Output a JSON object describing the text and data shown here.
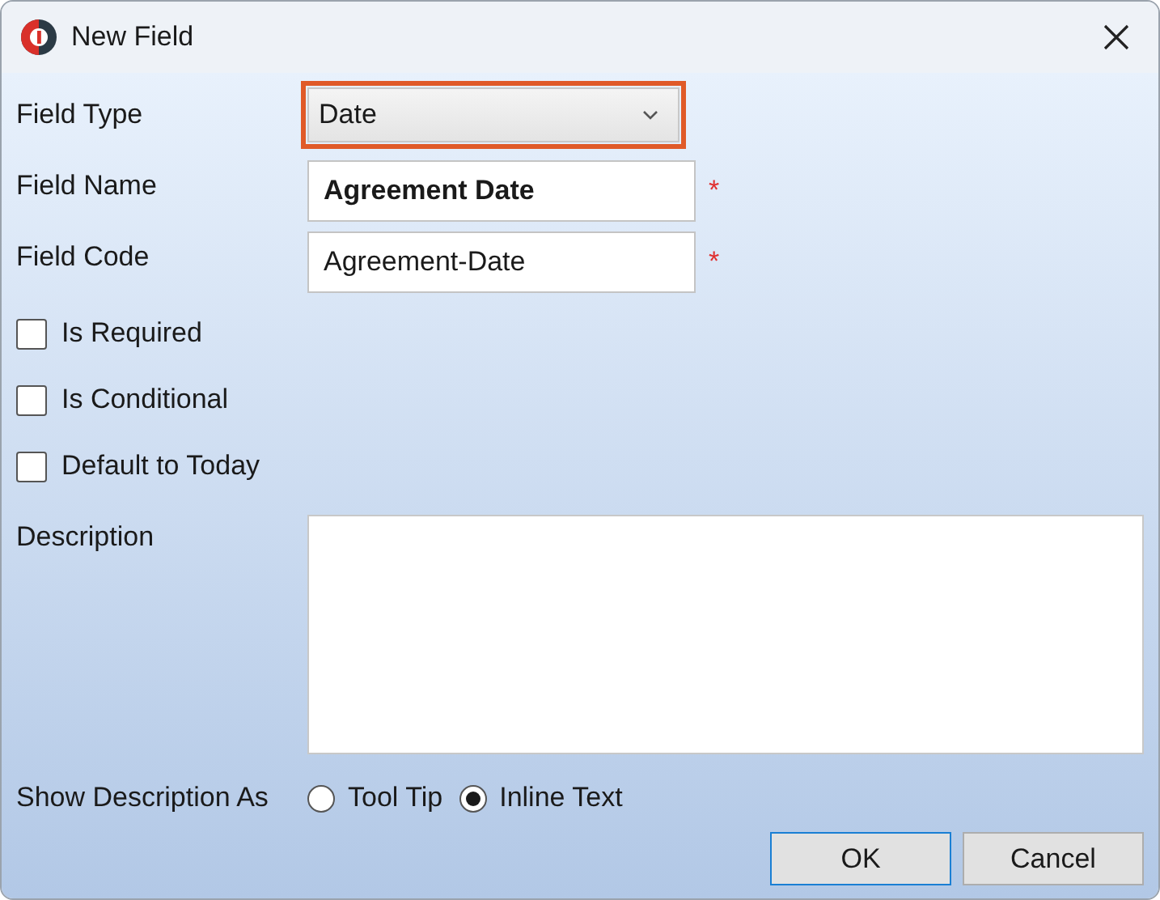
{
  "window": {
    "title": "New Field"
  },
  "field_type": {
    "label": "Field Type",
    "value": "Date",
    "highlighted": true
  },
  "field_name": {
    "label": "Field Name",
    "value": "Agreement Date",
    "required_mark": "*"
  },
  "field_code": {
    "label": "Field Code",
    "value": "Agreement-Date",
    "required_mark": "*"
  },
  "checkboxes": [
    {
      "label": "Is Required",
      "checked": false
    },
    {
      "label": "Is Conditional",
      "checked": false
    },
    {
      "label": "Default to Today",
      "checked": false
    }
  ],
  "description": {
    "label": "Description"
  },
  "show_description_as": {
    "label": "Show Description As",
    "options": [
      {
        "label": "Tool Tip",
        "selected": false
      },
      {
        "label": "Inline Text",
        "selected": true
      }
    ]
  },
  "buttons": [
    {
      "label": "OK",
      "default": true
    },
    {
      "label": "Cancel",
      "default": false
    }
  ]
}
